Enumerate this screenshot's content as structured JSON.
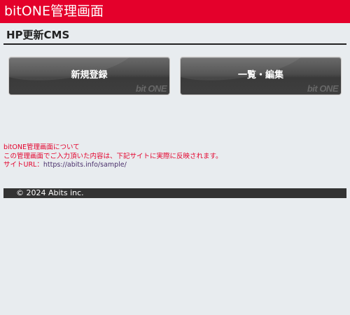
{
  "header": {
    "app_title": "bitONE管理画面"
  },
  "section": {
    "title": "HP更新CMS"
  },
  "buttons": [
    {
      "label": "新規登録",
      "watermark": "bit ONE"
    },
    {
      "label": "一覧・編集",
      "watermark": "bit ONE"
    }
  ],
  "info": {
    "line1": "bitONE管理画面について",
    "line2": "この管理画面でご入力頂いた内容は、下記サイトに実際に反映されます。",
    "url_label": "サイトURL：",
    "url": "https://abits.info/sample/"
  },
  "footer": {
    "copyright": "© 2024 Abits inc."
  },
  "colors": {
    "brand_red": "#e4002b",
    "background": "#e8ecef",
    "button_dark": "#3f3f3f",
    "footer_bg": "#333333",
    "link": "#4a2f6b"
  }
}
